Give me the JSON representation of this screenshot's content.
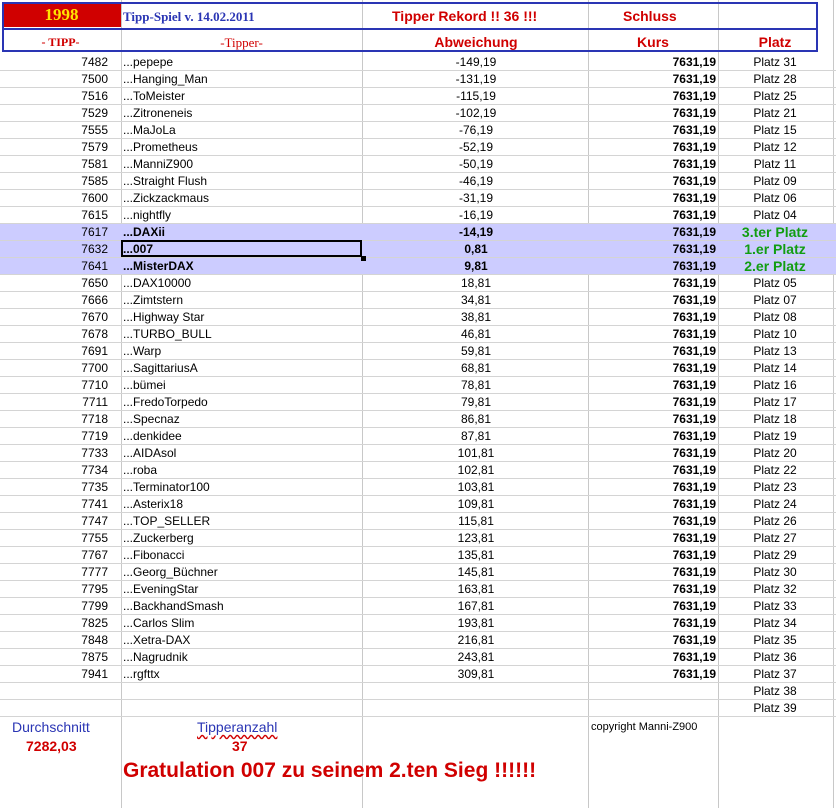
{
  "header": {
    "year": "1998",
    "game_title": "Tipp-Spiel v. 14.02.2011",
    "record": "Tipper Rekord !!  36  !!!",
    "schluss": "Schluss",
    "col_tipp": "- TIPP-",
    "col_tipper": "-Tipper-",
    "col_abweichung": "Abweichung",
    "col_kurs": "Kurs",
    "col_platz": "Platz"
  },
  "rows": [
    {
      "tipp": "7482",
      "name": "...pepepe",
      "dev": "-149,19",
      "kurs": "7631,19",
      "platz": "Platz 31"
    },
    {
      "tipp": "7500",
      "name": "...Hanging_Man",
      "dev": "-131,19",
      "kurs": "7631,19",
      "platz": "Platz 28"
    },
    {
      "tipp": "7516",
      "name": "...ToMeister",
      "dev": "-115,19",
      "kurs": "7631,19",
      "platz": "Platz 25"
    },
    {
      "tipp": "7529",
      "name": "...Zitroneneis",
      "dev": "-102,19",
      "kurs": "7631,19",
      "platz": "Platz 21"
    },
    {
      "tipp": "7555",
      "name": "...MaJoLa",
      "dev": "-76,19",
      "kurs": "7631,19",
      "platz": "Platz 15"
    },
    {
      "tipp": "7579",
      "name": "...Prometheus",
      "dev": "-52,19",
      "kurs": "7631,19",
      "platz": "Platz 12"
    },
    {
      "tipp": "7581",
      "name": "...ManniZ900",
      "dev": "-50,19",
      "kurs": "7631,19",
      "platz": "Platz 11"
    },
    {
      "tipp": "7585",
      "name": "...Straight Flush",
      "dev": "-46,19",
      "kurs": "7631,19",
      "platz": "Platz 09"
    },
    {
      "tipp": "7600",
      "name": "...Zickzackmaus",
      "dev": "-31,19",
      "kurs": "7631,19",
      "platz": "Platz 06"
    },
    {
      "tipp": "7615",
      "name": "...nightfly",
      "dev": "-16,19",
      "kurs": "7631,19",
      "platz": "Platz 04"
    },
    {
      "tipp": "7617",
      "name": "...DAXii",
      "dev": "-14,19",
      "kurs": "7631,19",
      "platz": "3.ter Platz"
    },
    {
      "tipp": "7632",
      "name": "...007",
      "dev": "0,81",
      "kurs": "7631,19",
      "platz": "1.er Platz"
    },
    {
      "tipp": "7641",
      "name": "...MisterDAX",
      "dev": "9,81",
      "kurs": "7631,19",
      "platz": "2.er Platz"
    },
    {
      "tipp": "7650",
      "name": "...DAX10000",
      "dev": "18,81",
      "kurs": "7631,19",
      "platz": "Platz 05"
    },
    {
      "tipp": "7666",
      "name": "...Zimtstern",
      "dev": "34,81",
      "kurs": "7631,19",
      "platz": "Platz 07"
    },
    {
      "tipp": "7670",
      "name": "...Highway Star",
      "dev": "38,81",
      "kurs": "7631,19",
      "platz": "Platz 08"
    },
    {
      "tipp": "7678",
      "name": "...TURBO_BULL",
      "dev": "46,81",
      "kurs": "7631,19",
      "platz": "Platz 10"
    },
    {
      "tipp": "7691",
      "name": "...Warp",
      "dev": "59,81",
      "kurs": "7631,19",
      "platz": "Platz 13"
    },
    {
      "tipp": "7700",
      "name": "...SagittariusA",
      "dev": "68,81",
      "kurs": "7631,19",
      "platz": "Platz 14"
    },
    {
      "tipp": "7710",
      "name": "...bümei",
      "dev": "78,81",
      "kurs": "7631,19",
      "platz": "Platz 16"
    },
    {
      "tipp": "7711",
      "name": "...FredoTorpedo",
      "dev": "79,81",
      "kurs": "7631,19",
      "platz": "Platz 17"
    },
    {
      "tipp": "7718",
      "name": "...Specnaz",
      "dev": "86,81",
      "kurs": "7631,19",
      "platz": "Platz 18"
    },
    {
      "tipp": "7719",
      "name": "...denkidee",
      "dev": "87,81",
      "kurs": "7631,19",
      "platz": "Platz 19"
    },
    {
      "tipp": "7733",
      "name": "...AIDAsol",
      "dev": "101,81",
      "kurs": "7631,19",
      "platz": "Platz 20"
    },
    {
      "tipp": "7734",
      "name": "...roba",
      "dev": "102,81",
      "kurs": "7631,19",
      "platz": "Platz 22"
    },
    {
      "tipp": "7735",
      "name": "...Terminator100",
      "dev": "103,81",
      "kurs": "7631,19",
      "platz": "Platz 23"
    },
    {
      "tipp": "7741",
      "name": "...Asterix18",
      "dev": "109,81",
      "kurs": "7631,19",
      "platz": "Platz 24"
    },
    {
      "tipp": "7747",
      "name": "...TOP_SELLER",
      "dev": "115,81",
      "kurs": "7631,19",
      "platz": "Platz 26"
    },
    {
      "tipp": "7755",
      "name": "...Zuckerberg",
      "dev": "123,81",
      "kurs": "7631,19",
      "platz": "Platz 27"
    },
    {
      "tipp": "7767",
      "name": "...Fibonacci",
      "dev": "135,81",
      "kurs": "7631,19",
      "platz": "Platz 29"
    },
    {
      "tipp": "7777",
      "name": "...Georg_Büchner",
      "dev": "145,81",
      "kurs": "7631,19",
      "platz": "Platz 30"
    },
    {
      "tipp": "7795",
      "name": "...EveningStar",
      "dev": "163,81",
      "kurs": "7631,19",
      "platz": "Platz 32"
    },
    {
      "tipp": "7799",
      "name": "...BackhandSmash",
      "dev": "167,81",
      "kurs": "7631,19",
      "platz": "Platz 33"
    },
    {
      "tipp": "7825",
      "name": "...Carlos Slim",
      "dev": "193,81",
      "kurs": "7631,19",
      "platz": "Platz 34"
    },
    {
      "tipp": "7848",
      "name": "...Xetra-DAX",
      "dev": "216,81",
      "kurs": "7631,19",
      "platz": "Platz 35"
    },
    {
      "tipp": "7875",
      "name": "...Nagrudnik",
      "dev": "243,81",
      "kurs": "7631,19",
      "platz": "Platz 36"
    },
    {
      "tipp": "7941",
      "name": "...rgfttx",
      "dev": "309,81",
      "kurs": "7631,19",
      "platz": "Platz 37"
    },
    {
      "tipp": "",
      "name": "",
      "dev": "",
      "kurs": "",
      "platz": "Platz 38"
    },
    {
      "tipp": "",
      "name": "",
      "dev": "",
      "kurs": "",
      "platz": "Platz 39"
    }
  ],
  "footer": {
    "durchschnitt_label": "Durchschnitt",
    "durchschnitt_value": "7282,03",
    "tipperanzahl_label": "Tipperanzahl",
    "tipperanzahl_value": "37",
    "copyright": "copyright Manni-Z900",
    "gratulation": "Gratulation 007 zu seinem 2.ten Sieg !!!!!!"
  },
  "colors": {
    "blue": "#2a35b4",
    "red": "#d00000",
    "yellow": "#ffe400",
    "green": "#119d11",
    "highlight": "#ccccff"
  }
}
